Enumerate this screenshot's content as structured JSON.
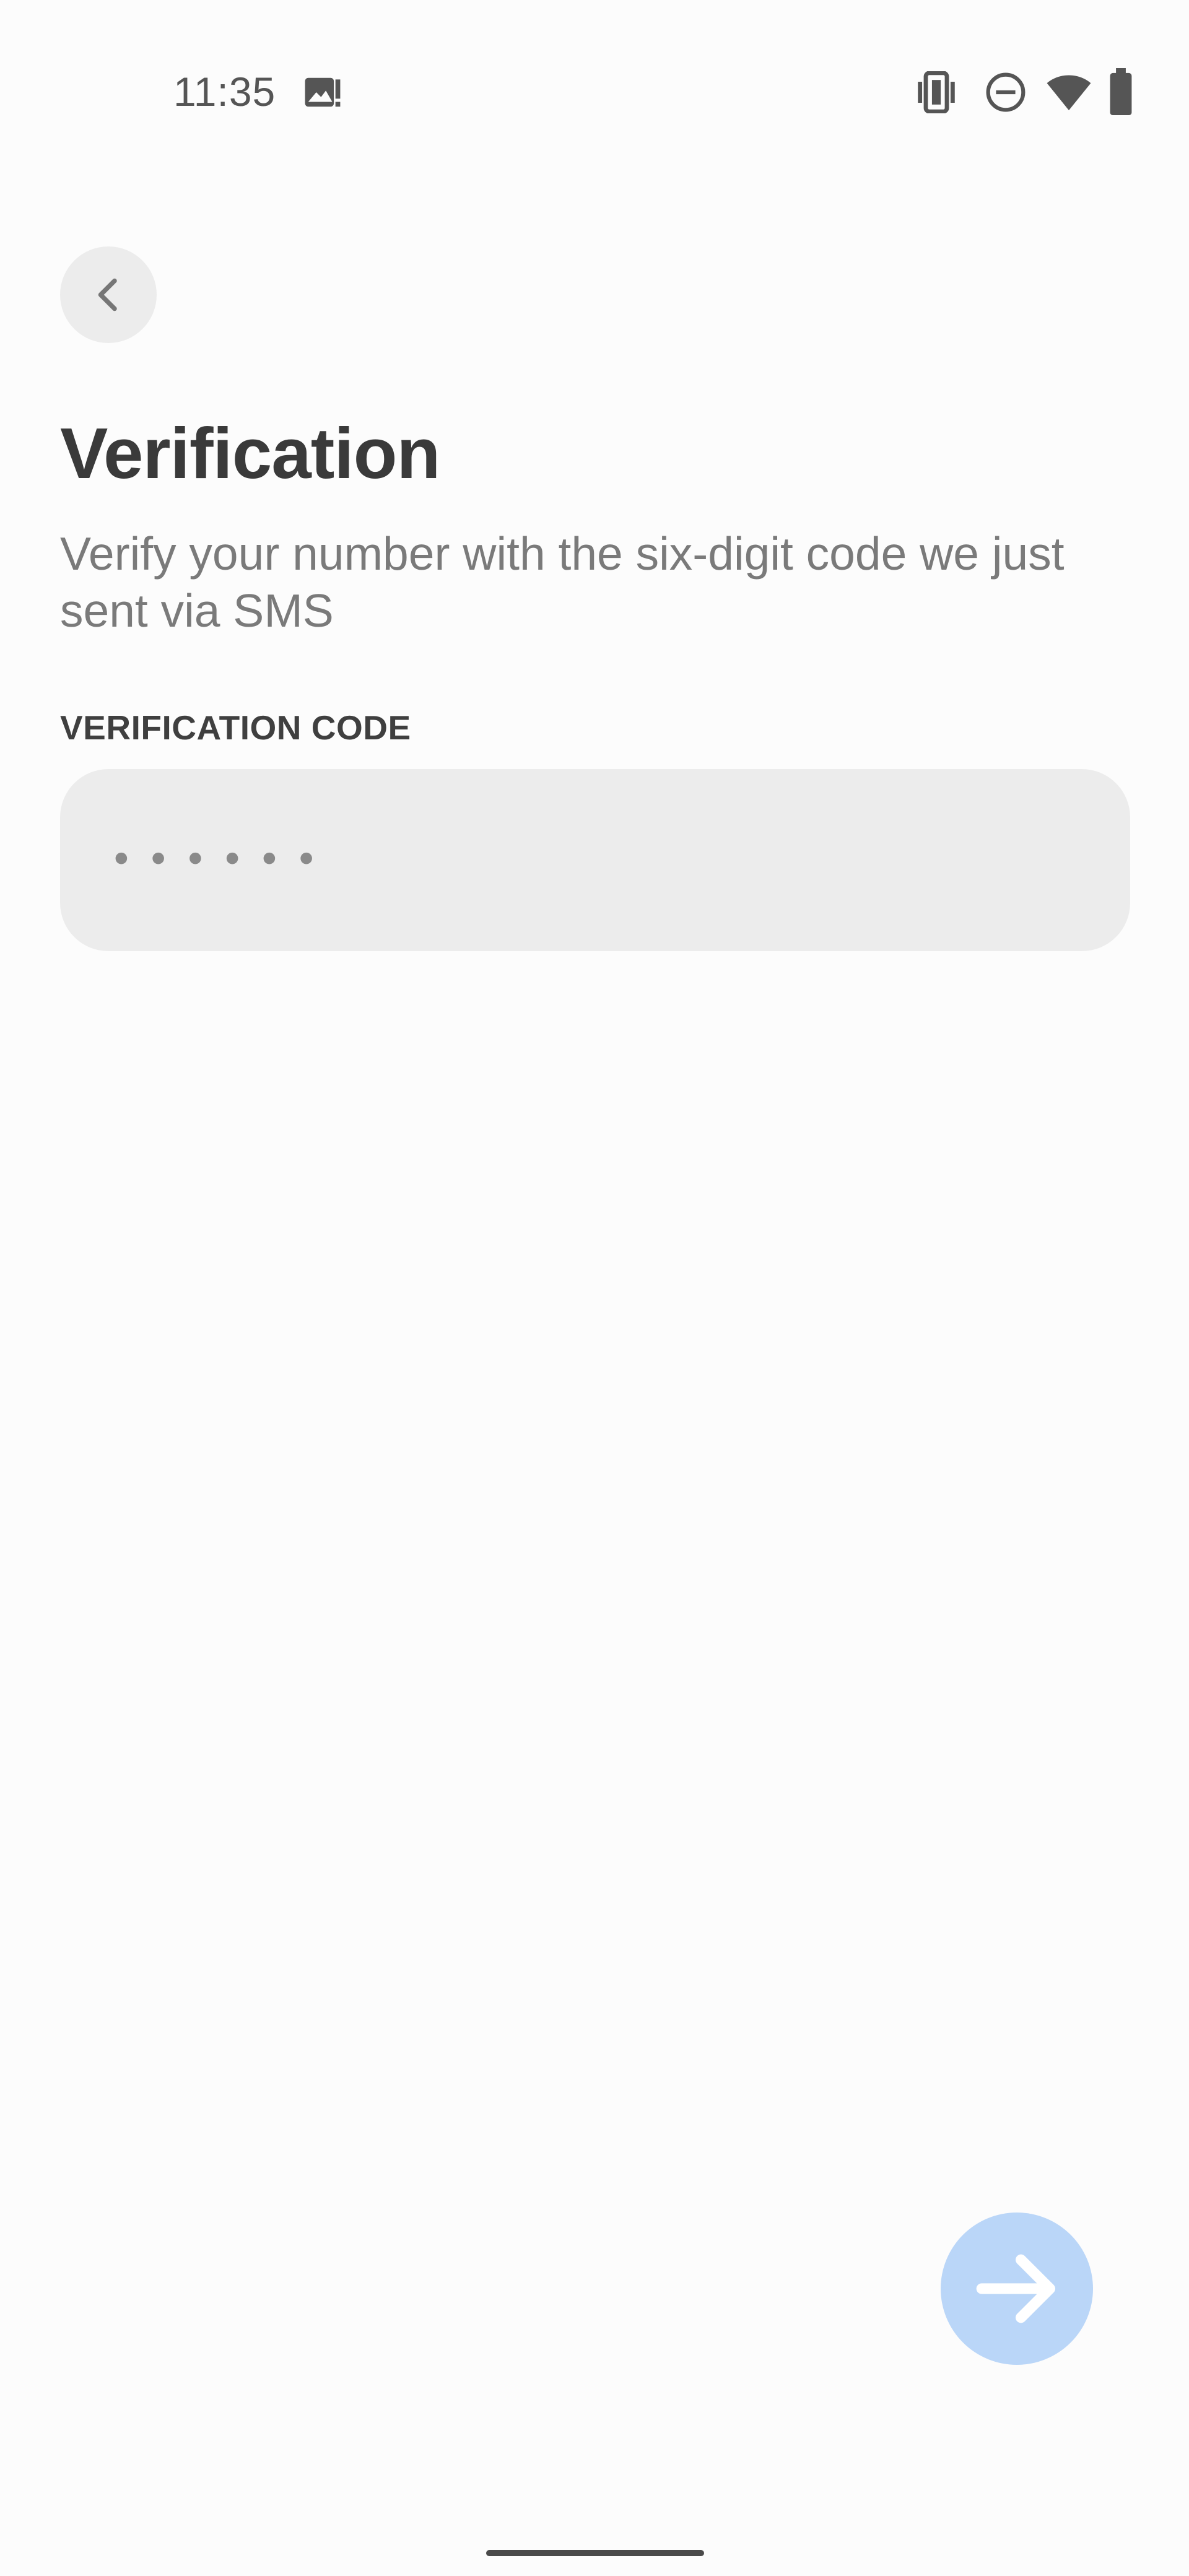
{
  "status_bar": {
    "time": "11:35",
    "icons": [
      "gallery-notification-icon",
      "vibrate-icon",
      "do-not-disturb-icon",
      "wifi-icon",
      "battery-icon"
    ]
  },
  "header": {
    "back_icon": "chevron-left-icon",
    "title": "Verification",
    "subtitle": "Verify your number with the six-digit code we just sent via SMS"
  },
  "form": {
    "code_label": "VERIFICATION CODE",
    "code_value": "",
    "code_placeholder": "••••••"
  },
  "actions": {
    "next_icon": "arrow-right-icon"
  },
  "colors": {
    "background": "#fcfcfc",
    "field_background": "#ececec",
    "next_button": "#bad6f8",
    "next_arrow": "#ffffff",
    "title_text": "#3a3a3a",
    "subtitle_text": "#7a7a7a"
  }
}
